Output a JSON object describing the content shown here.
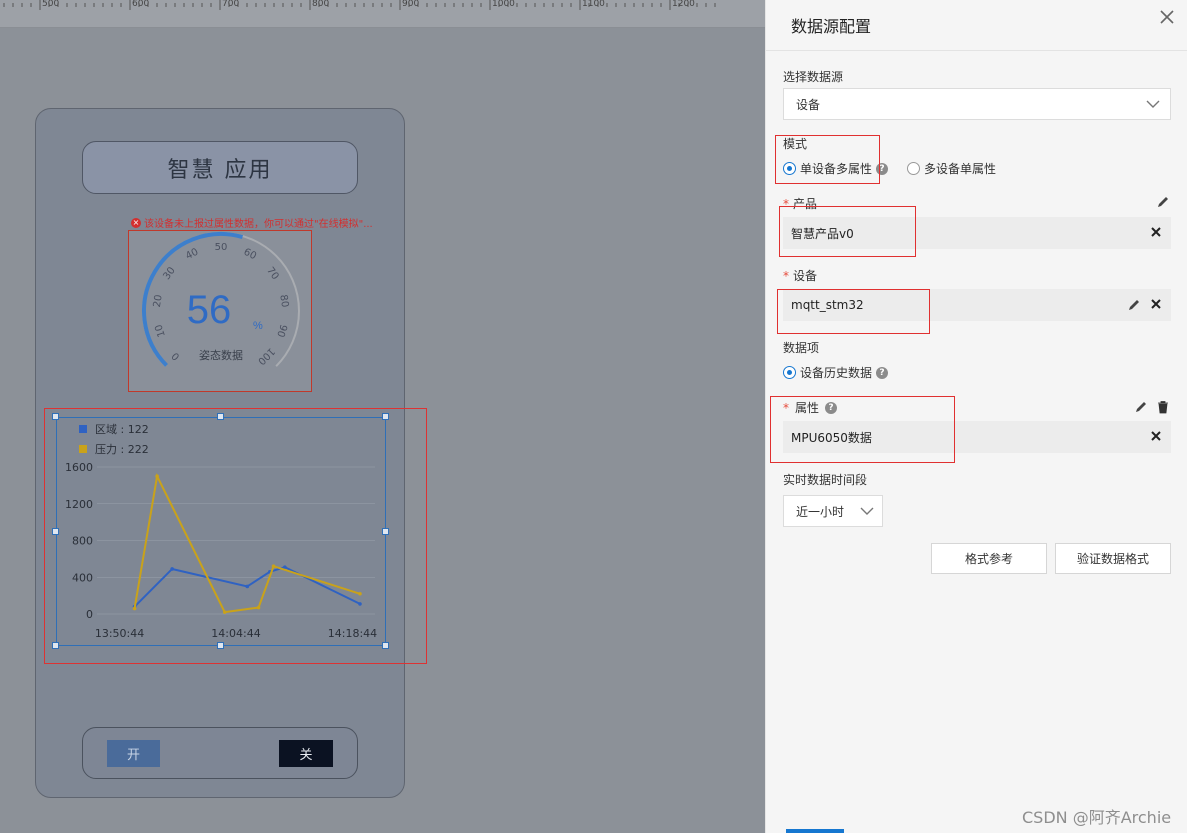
{
  "ruler": {
    "ticks": [
      "500",
      "600",
      "700",
      "800",
      "900",
      "1000",
      "1100",
      "1200"
    ]
  },
  "phone": {
    "title": "智慧    应用",
    "warning": "该设备未上报过属性数据，你可以通过\"在线模拟\"...",
    "gauge": {
      "value": "56",
      "unit": "%",
      "label": "姿态数据",
      "ticks": [
        "0",
        "10",
        "20",
        "30",
        "40",
        "50",
        "60",
        "70",
        "80",
        "90",
        "100"
      ],
      "percent": 56
    },
    "btn_on": "开",
    "btn_off": "关"
  },
  "chart_data": {
    "type": "line",
    "legend": [
      {
        "name": "区域 : 122",
        "color": "#2f62c2"
      },
      {
        "name": "压力 : 222",
        "color": "#c9a21a"
      }
    ],
    "yticks": [
      "1600",
      "1200",
      "800",
      "400",
      "0"
    ],
    "xticks": [
      "13:50:44",
      "14:04:44",
      "14:18:44"
    ],
    "ylim": [
      0,
      1600
    ],
    "series": [
      {
        "name": "区域 : 122",
        "color": "#2f62c2",
        "points": [
          [
            1,
            80
          ],
          [
            2,
            490
          ],
          [
            4,
            300
          ],
          [
            4.6,
            460
          ],
          [
            5,
            510
          ],
          [
            7,
            110
          ]
        ]
      },
      {
        "name": "压力 : 222",
        "color": "#c9a21a",
        "points": [
          [
            1,
            60
          ],
          [
            1.6,
            1500
          ],
          [
            3.4,
            20
          ],
          [
            4.3,
            70
          ],
          [
            4.7,
            520
          ],
          [
            7,
            220
          ]
        ]
      }
    ]
  },
  "panel": {
    "title": "数据源配置",
    "source_label": "选择数据源",
    "source_value": "设备",
    "mode_label": "模式",
    "mode_opt1": "单设备多属性",
    "mode_opt2": "多设备单属性",
    "product_label": "产品",
    "product_value": "智慧产品v0",
    "device_label": "设备",
    "device_value": "mqtt_stm32",
    "data_label": "数据项",
    "data_opt": "设备历史数据",
    "attr_label": "属性",
    "attr_value": "MPU6050数据",
    "period_label": "实时数据时间段",
    "period_value": "近一小时",
    "btn_format": "格式参考",
    "btn_verify": "验证数据格式"
  },
  "watermark": "CSDN @阿齐Archie"
}
